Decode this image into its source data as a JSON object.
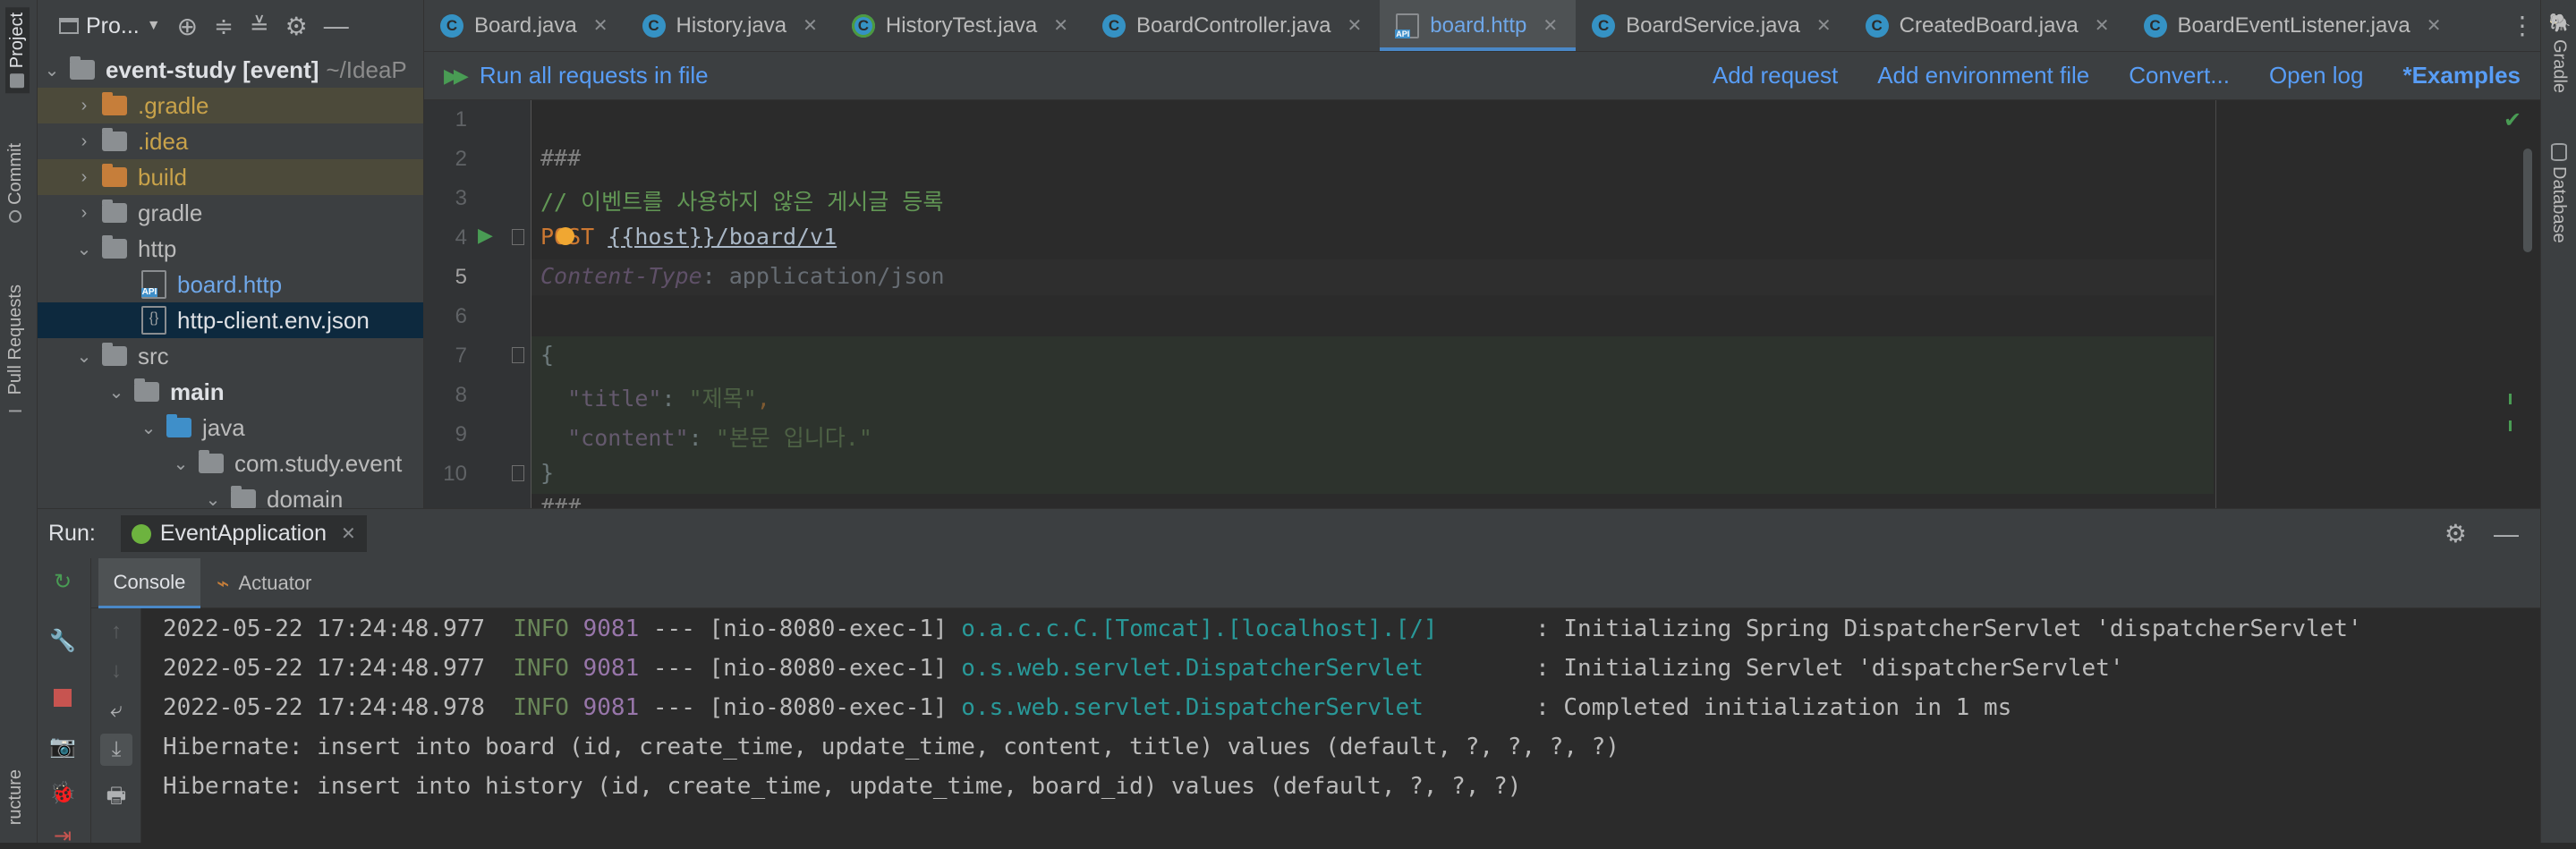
{
  "left_strip": {
    "project": "Project",
    "commit": "Commit",
    "pull_requests": "Pull Requests",
    "structure": "ructure"
  },
  "right_strip": {
    "gradle": "Gradle",
    "database": "Database"
  },
  "project_panel": {
    "title": "Pro...",
    "tree": [
      {
        "name": "event-study [event]",
        "suffix": "~/IdeaP",
        "type": "root",
        "expanded": true
      },
      {
        "name": ".gradle",
        "type": "folder-excluded"
      },
      {
        "name": ".idea",
        "type": "folder"
      },
      {
        "name": "build",
        "type": "folder-excluded"
      },
      {
        "name": "gradle",
        "type": "folder"
      },
      {
        "name": "http",
        "type": "folder",
        "expanded": true
      },
      {
        "name": "board.http",
        "type": "file-api"
      },
      {
        "name": "http-client.env.json",
        "type": "file-json",
        "selected": true
      },
      {
        "name": "src",
        "type": "folder",
        "expanded": true
      },
      {
        "name": "main",
        "type": "folder",
        "expanded": true
      },
      {
        "name": "java",
        "type": "folder-source",
        "expanded": true
      },
      {
        "name": "com.study.event",
        "type": "package",
        "expanded": true
      },
      {
        "name": "domain",
        "type": "package",
        "expanded": true
      }
    ]
  },
  "tabs": [
    {
      "label": "Board.java",
      "icon": "class-icon"
    },
    {
      "label": "History.java",
      "icon": "class-icon"
    },
    {
      "label": "HistoryTest.java",
      "icon": "test-class-icon"
    },
    {
      "label": "BoardController.java",
      "icon": "class-icon"
    },
    {
      "label": "board.http",
      "icon": "api-file-icon",
      "active": true
    },
    {
      "label": "BoardService.java",
      "icon": "class-icon"
    },
    {
      "label": "CreatedBoard.java",
      "icon": "class-icon"
    },
    {
      "label": "BoardEventListener.java",
      "icon": "class-icon"
    }
  ],
  "request_toolbar": {
    "run_all": "Run all requests in file",
    "add_request": "Add request",
    "add_env": "Add environment file",
    "convert": "Convert...",
    "open_log": "Open log",
    "examples": "*Examples"
  },
  "editor": {
    "line_numbers": [
      "1",
      "2",
      "3",
      "4",
      "5",
      "6",
      "7",
      "8",
      "9",
      "10"
    ],
    "lines": {
      "l2": "###",
      "l3": "// 이벤트를 사용하지 않은 게시글 등록",
      "l4_method": "POST",
      "l4_url": "{{host}}/board/v1",
      "l5_key": "Content-Type",
      "l5_value": ": application/json",
      "l7": "{",
      "l8_key": "\"title\"",
      "l8_colon": ": ",
      "l8_value": "\"제목\"",
      "l8_comma": ",",
      "l9_key": "\"content\"",
      "l9_colon": ": ",
      "l9_value": "\"본문 입니다.\"",
      "l10": "}",
      "l11": "###"
    }
  },
  "run_panel": {
    "label": "Run:",
    "config": "EventApplication",
    "tabs": {
      "console": "Console",
      "actuator": "Actuator"
    },
    "console_lines": [
      {
        "ts": "2022-05-22 17:24:48.977",
        "level": "INFO",
        "pid": "9081",
        "thread": " --- [nio-8080-exec-1] ",
        "logger": "o.a.c.c.C.[Tomcat].[localhost].[/]      ",
        "msg": " : Initializing Spring DispatcherServlet 'dispatcherServlet'"
      },
      {
        "ts": "2022-05-22 17:24:48.977",
        "level": "INFO",
        "pid": "9081",
        "thread": " --- [nio-8080-exec-1] ",
        "logger": "o.s.web.servlet.DispatcherServlet       ",
        "msg": " : Initializing Servlet 'dispatcherServlet'"
      },
      {
        "ts": "2022-05-22 17:24:48.978",
        "level": "INFO",
        "pid": "9081",
        "thread": " --- [nio-8080-exec-1] ",
        "logger": "o.s.web.servlet.DispatcherServlet       ",
        "msg": " : Completed initialization in 1 ms"
      }
    ],
    "hibernate_lines": [
      "Hibernate: insert into board (id, create_time, update_time, content, title) values (default, ?, ?, ?, ?)",
      "Hibernate: insert into history (id, create_time, update_time, board_id) values (default, ?, ?, ?)"
    ]
  },
  "colors": {
    "accent": "#589df6",
    "info": "#6a8759",
    "pid": "#9876aa",
    "logger": "#299999",
    "string": "#6a8759",
    "keyword": "#cc7832"
  }
}
